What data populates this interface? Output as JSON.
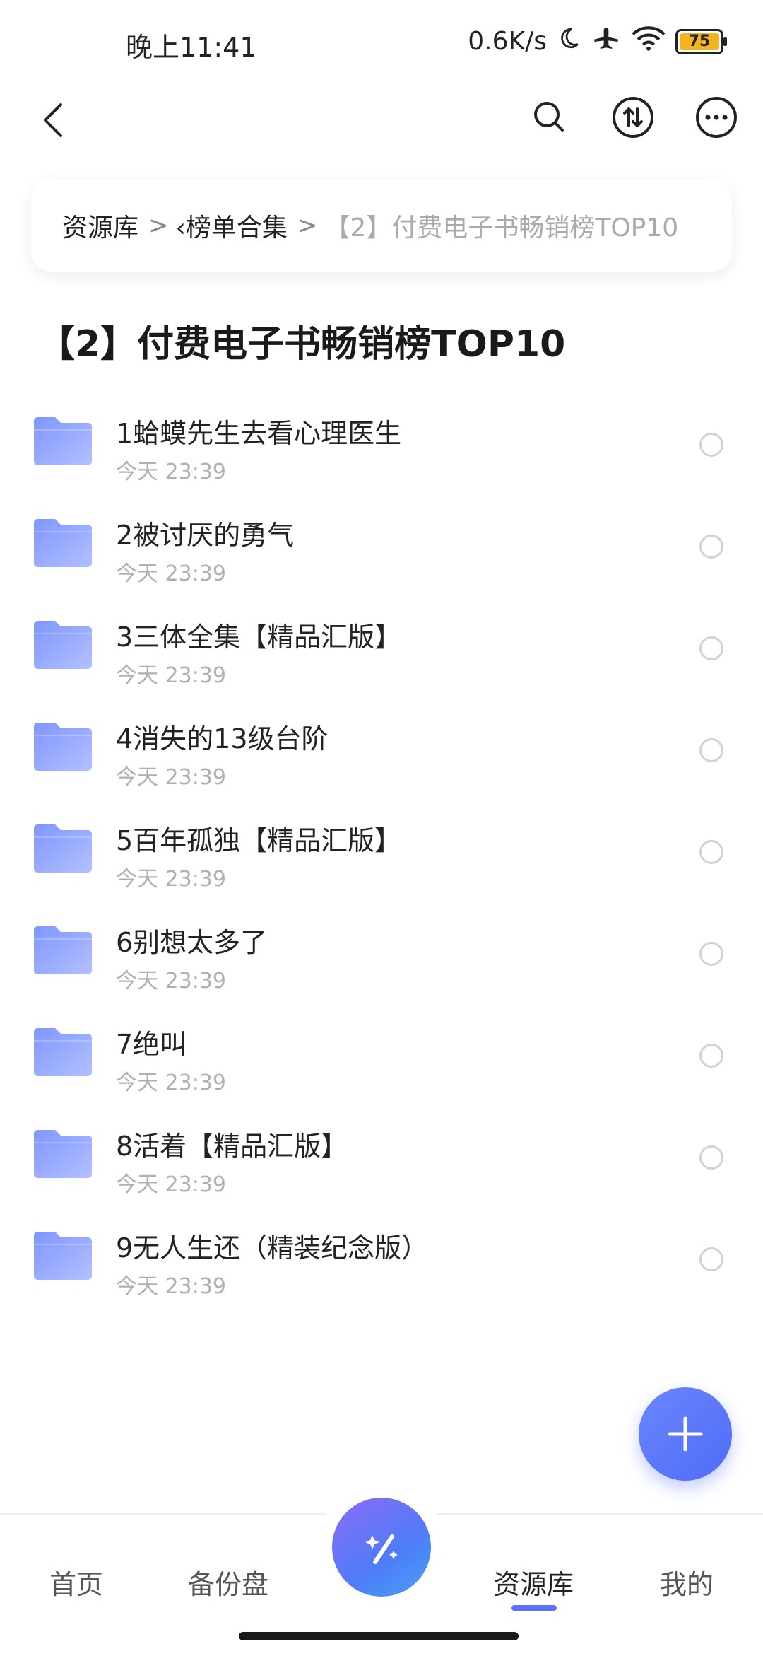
{
  "status_bar": {
    "time": "晚上11:41",
    "speed": "0.6K/s",
    "battery": "75"
  },
  "breadcrumb": {
    "root": "资源库",
    "middle": "‹榜单合集",
    "current": "【2】付费电子书畅销榜TOP10"
  },
  "page_title": "【2】付费电子书畅销榜TOP10",
  "items": [
    {
      "title": "1蛤蟆先生去看心理医生",
      "time": "今天 23:39"
    },
    {
      "title": "2被讨厌的勇气",
      "time": "今天 23:39"
    },
    {
      "title": "3三体全集【精品汇版】",
      "time": "今天 23:39"
    },
    {
      "title": "4消失的13级台阶",
      "time": "今天 23:39"
    },
    {
      "title": "5百年孤独【精品汇版】",
      "time": "今天 23:39"
    },
    {
      "title": "6别想太多了",
      "time": "今天 23:39"
    },
    {
      "title": "7绝叫",
      "time": "今天 23:39"
    },
    {
      "title": "8活着【精品汇版】",
      "time": "今天 23:39"
    },
    {
      "title": "9无人生还（精装纪念版）",
      "time": "今天 23:39"
    }
  ],
  "bottom_nav": {
    "home": "首页",
    "backup": "备份盘",
    "library": "资源库",
    "mine": "我的"
  },
  "colors": {
    "accent": "#5b74f5",
    "folder": "#8ea2ff",
    "battery": "#f4b320"
  }
}
